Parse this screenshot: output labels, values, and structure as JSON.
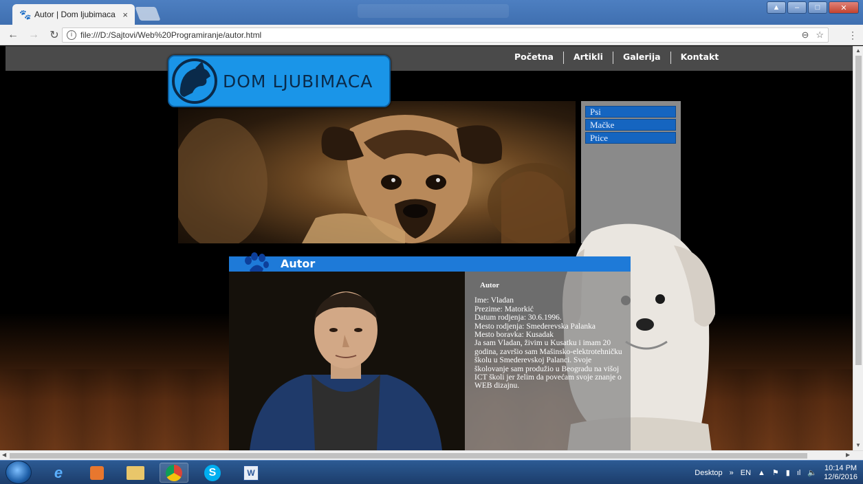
{
  "browser": {
    "tab_title": "Autor | Dom ljubimaca",
    "tab_close": "×",
    "url": "file:///D:/Sajtovi/Web%20Programiranje/autor.html",
    "icons": [
      "back-arrow-icon",
      "forward-arrow-icon",
      "reload-icon",
      "info-icon",
      "zoom-icon",
      "star-icon",
      "menu-dots-icon"
    ]
  },
  "site": {
    "logo_text": "DOM LJUBIMACA",
    "nav": [
      "Početna",
      "Artikli",
      "Galerija",
      "Kontakt"
    ],
    "side_menu": [
      "Psi",
      "Mačke",
      "Ptice"
    ],
    "panel_title": "Autor",
    "info": {
      "heading": "Autor",
      "lines": [
        "Ime: Vladan",
        "Prezime: Matorkić",
        "Datum rodjenja: 30.6.1996.",
        "Mesto rodjenja: Smederevska Palanka",
        "Mesto boravka: Kusadak"
      ],
      "bio": "Ja sam Vladan, živim u Kusatku i imam 20 godina, završio sam Mašinsko-elektrotehničku školu u Smederevskoj Palanci. Svoje školovanje sam produžio u Beogradu na višoj ICT školi jer želim da povećam svoje znanje o WEB dizajnu."
    }
  },
  "taskbar": {
    "apps": [
      "internet-explorer-icon",
      "media-player-icon",
      "file-explorer-icon",
      "chrome-icon",
      "skype-icon",
      "word-icon"
    ],
    "desktop_label": "Desktop",
    "chevron": "»",
    "lang": "EN",
    "time": "10:14 PM",
    "date": "12/6/2016"
  },
  "colors": {
    "accent_blue": "#1e7ad8",
    "nav_bg": "#4a4a4a",
    "logo_bg": "#1a95e8"
  }
}
